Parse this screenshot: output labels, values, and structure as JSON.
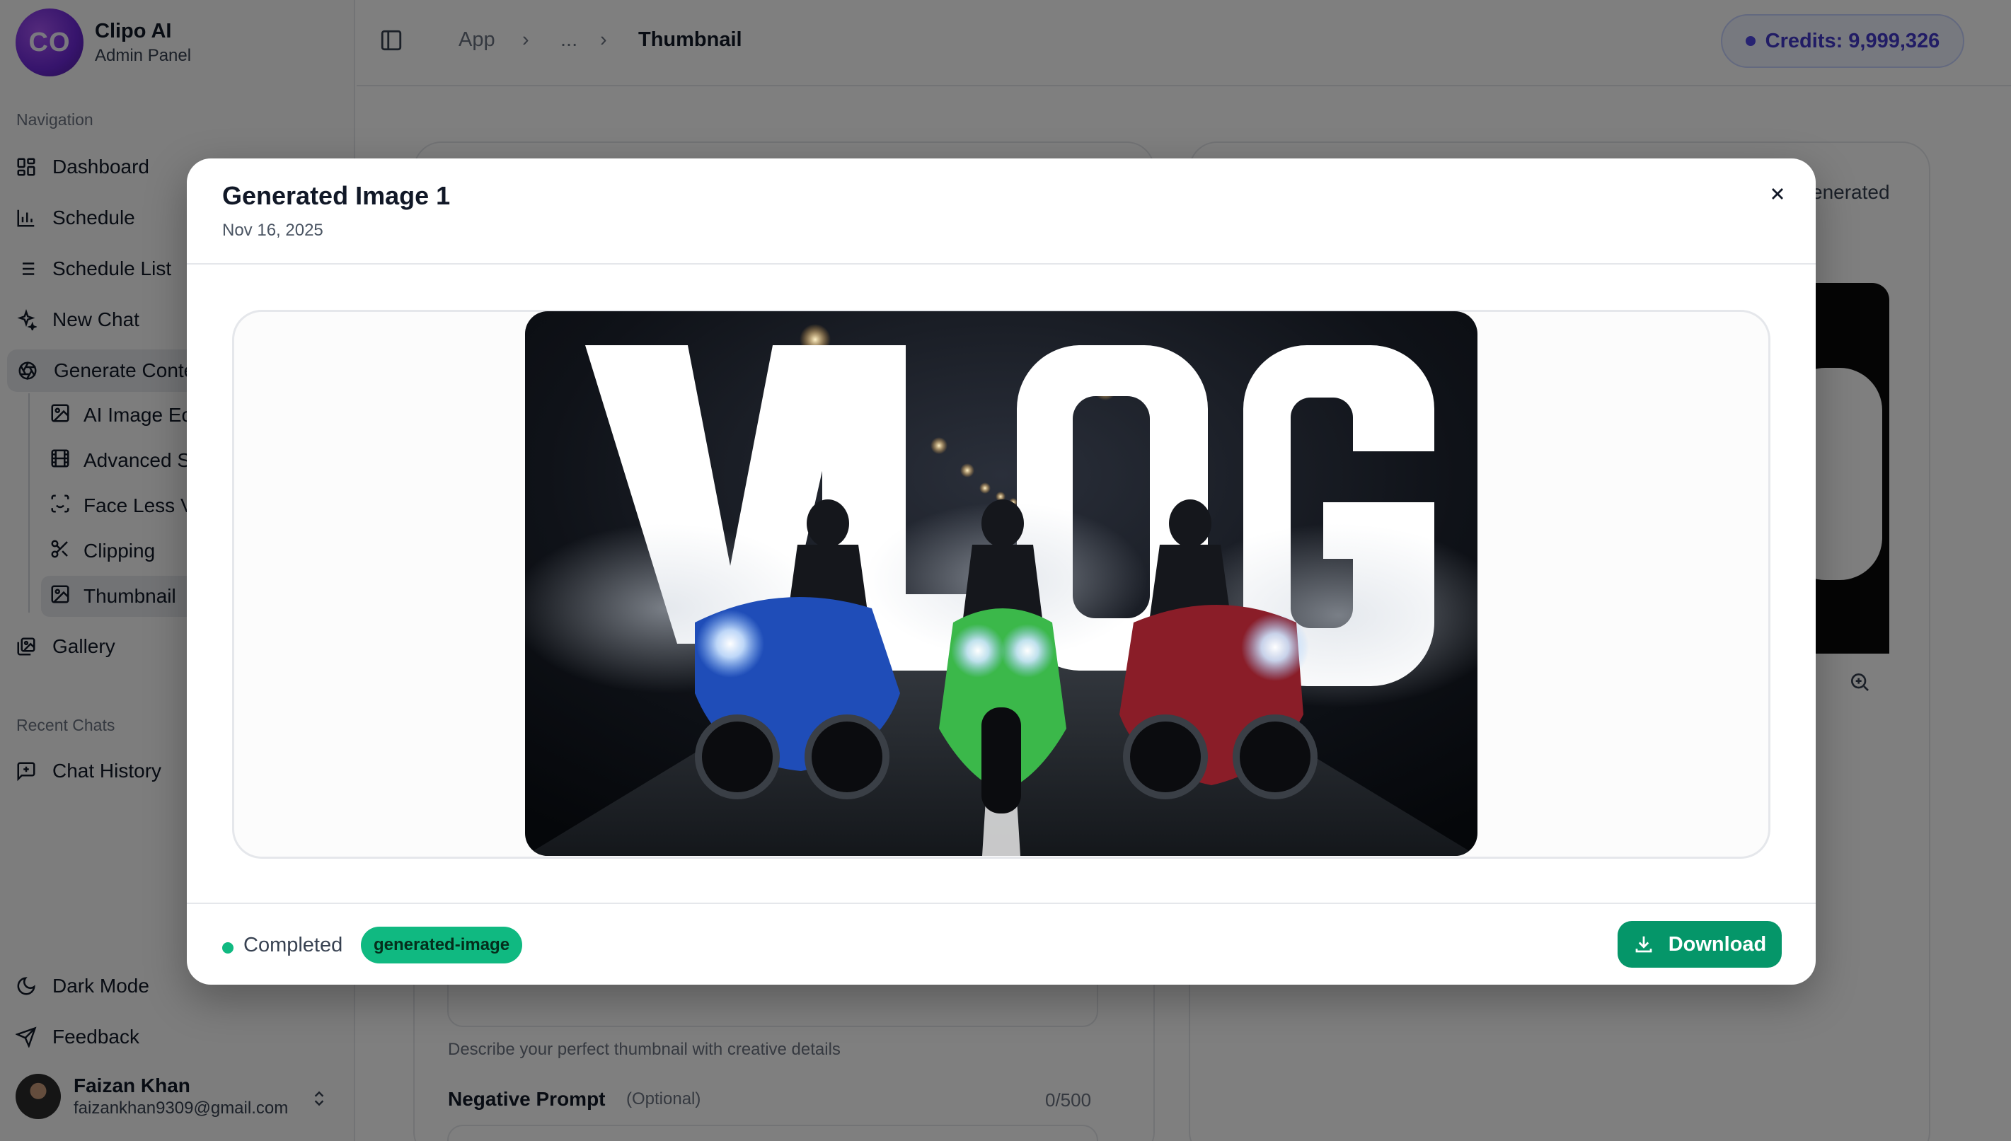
{
  "brand": {
    "logo_text": "CO",
    "name": "Clipo AI",
    "subtitle": "Admin Panel"
  },
  "sidebar": {
    "navigation_label": "Navigation",
    "items": [
      {
        "label": "Dashboard",
        "icon": "dashboard-icon"
      },
      {
        "label": "Schedule",
        "icon": "bar-chart-icon"
      },
      {
        "label": "Schedule List",
        "icon": "list-icon"
      },
      {
        "label": "New Chat",
        "icon": "sparkles-icon"
      },
      {
        "label": "Generate Conte",
        "icon": "aperture-icon"
      }
    ],
    "sub_items": [
      {
        "label": "AI Image Ec",
        "icon": "image-edit-icon"
      },
      {
        "label": "Advanced S",
        "icon": "film-icon"
      },
      {
        "label": "Face Less V",
        "icon": "scan-face-icon"
      },
      {
        "label": "Clipping",
        "icon": "scissors-icon"
      },
      {
        "label": "Thumbnail",
        "icon": "image-icon"
      }
    ],
    "gallery": {
      "label": "Gallery",
      "icon": "gallery-icon"
    },
    "recent_label": "Recent Chats",
    "chat_history": {
      "label": "Chat History",
      "icon": "message-plus-icon"
    },
    "dark_mode": {
      "label": "Dark Mode",
      "icon": "moon-icon"
    },
    "feedback": {
      "label": "Feedback",
      "icon": "send-icon"
    },
    "user": {
      "name": "Faizan Khan",
      "email": "faizankhan9309@gmail.com"
    }
  },
  "topbar": {
    "breadcrumb": [
      "App",
      "...",
      "Thumbnail"
    ],
    "credits": "Credits: 9,999,326"
  },
  "background": {
    "prompt_hint": "Describe your perfect thumbnail with creative details",
    "negative_label": "Negative Prompt",
    "negative_optional": "(Optional)",
    "negative_count": "0/500",
    "right_generated": "enerated"
  },
  "modal": {
    "title": "Generated Image 1",
    "date": "Nov 16, 2025",
    "image_text": "VLOG",
    "status": "Completed",
    "tag": "generated-image",
    "download_label": "Download"
  },
  "colors": {
    "accent": "#059669",
    "status": "#10b981",
    "credits": "#4338ca"
  }
}
